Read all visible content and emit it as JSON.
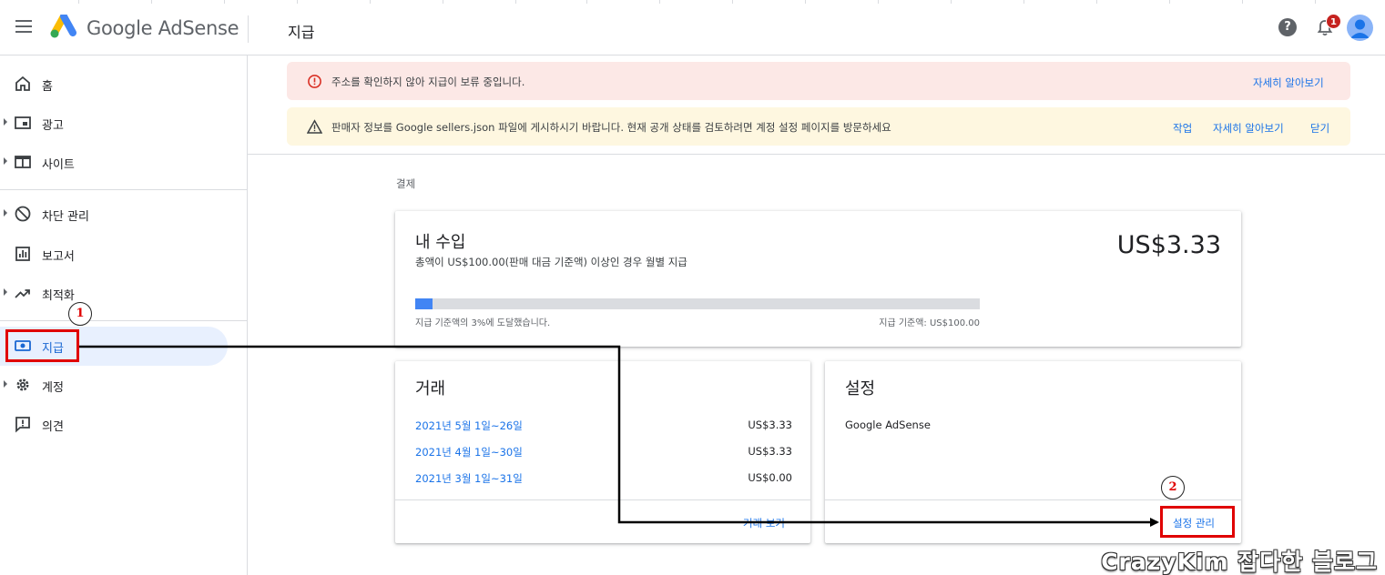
{
  "header": {
    "logo_text": "Google AdSense",
    "page_title": "지급",
    "help_symbol": "?",
    "notification_count": "1"
  },
  "sidebar": {
    "items": [
      {
        "label": "홈",
        "icon": "home-icon",
        "expandable": false
      },
      {
        "label": "광고",
        "icon": "ads-icon",
        "expandable": true
      },
      {
        "label": "사이트",
        "icon": "sites-icon",
        "expandable": true
      },
      {
        "label": "차단 관리",
        "icon": "block-icon",
        "expandable": true
      },
      {
        "label": "보고서",
        "icon": "reports-icon",
        "expandable": false
      },
      {
        "label": "최적화",
        "icon": "trending-up-icon",
        "expandable": true
      },
      {
        "label": "지급",
        "icon": "payments-icon",
        "expandable": false,
        "active": true
      },
      {
        "label": "계정",
        "icon": "gear-icon",
        "expandable": true
      },
      {
        "label": "의견",
        "icon": "feedback-icon",
        "expandable": false
      }
    ]
  },
  "banners": {
    "error": {
      "text": "주소를 확인하지 않아 지급이 보류 중입니다.",
      "link": "자세히 알아보기"
    },
    "warning": {
      "text": "판매자 정보를 Google sellers.json 파일에 게시하시기 바랍니다. 현재 공개 상태를 검토하려면 계정 설정 페이지를 방문하세요",
      "action": "작업",
      "link": "자세히 알아보기",
      "dismiss": "닫기"
    }
  },
  "breadcrumb": "결제",
  "earnings": {
    "title": "내 수입",
    "subtitle": "총액이 US$100.00(판매 대금 기준액) 이상인 경우 월별 지급",
    "amount": "US$3.33",
    "progress_percent": 3,
    "progress_label": "지급 기준액의 3%에 도달했습니다.",
    "threshold_label": "지급 기준액: US$100.00"
  },
  "transactions": {
    "title": "거래",
    "rows": [
      {
        "period": "2021년 5월 1일~26일",
        "amount": "US$3.33"
      },
      {
        "period": "2021년 4월 1일~30일",
        "amount": "US$3.33"
      },
      {
        "period": "2021년 3월 1일~31일",
        "amount": "US$0.00"
      }
    ],
    "footer_link": "거래 보기"
  },
  "settings": {
    "title": "설정",
    "product": "Google AdSense",
    "footer_link": "설정 관리"
  },
  "annotations": {
    "step1": "1",
    "step2": "2",
    "color": "#e00000"
  },
  "watermark": "CrazyKim 잡다한 블로그",
  "colors": {
    "accent": "#1a73e8",
    "active_bg": "#e8f0fe",
    "error_bg": "#fce8e6",
    "warning_bg": "#fef7e0",
    "progress": "#4285f4"
  }
}
